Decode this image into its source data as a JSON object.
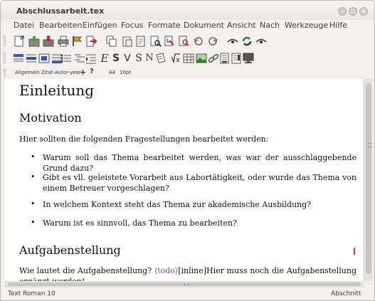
{
  "window": {
    "title": "Abschlussarbeit.tex"
  },
  "menubar": {
    "items": [
      "Datei",
      "Bearbeiten",
      "Einfügen",
      "Focus",
      "Formate",
      "Dokument",
      "Ansicht",
      "Nach",
      "Werkzeuge",
      "Hilfe"
    ]
  },
  "toolbar1": {
    "icons": [
      "new-document-icon",
      "open-icon",
      "save-icon",
      "print-icon",
      "bookmark-icon",
      "exit-icon",
      "copy-icon",
      "paste-icon",
      "view-icon",
      "find-icon",
      "find-replace-icon",
      "spellcheck-icon",
      "undo-icon",
      "redo-icon",
      "toc-icon",
      "refresh-icon",
      "outline-icon"
    ]
  },
  "toolbar2": {
    "glyphs": {
      "emph": "E",
      "strong": "S",
      "sans": "V",
      "smallcaps": "S",
      "noun": "N"
    }
  },
  "smallbar": {
    "module": "Allgemein",
    "cite_style": "Zitat-Autor-year",
    "add": "+",
    "help": "?",
    "paper": "A4",
    "fontsize": "10pt"
  },
  "document": {
    "heading1": "Einleitung",
    "section1": "Motivation",
    "intro": "Hier sollten die folgenden Fragestellungen bearbeitet werden:",
    "bullet_char": "•",
    "items": [
      "Warum soll das Thema bearbeitet werden, was war der ausschlaggebende Grund dazu?",
      "Gibt es vll. geleistete Vorarbeit aus Labortätigkeit, oder wurde das Thema von einem Betreuer vorgeschlagen?",
      "In welchem Kontext steht das Thema zur akademische Ausbildung?",
      "Warum ist es sinnvoll, das Thema zu bearbeiten?"
    ],
    "section2": "Aufgabenstellung",
    "last_para_prefix": "Wie lautet die Aufgabenstellung? ",
    "todo": "⟨todo⟩",
    "last_para_suffix": "[inline]Hier muss noch die Aufgabenstellung ergänzt werden!"
  },
  "status": {
    "font": "Text Roman 10",
    "layout": "Abschnitt"
  },
  "colors": {
    "todo": "#8e44ad",
    "cursor": "#e53935"
  }
}
